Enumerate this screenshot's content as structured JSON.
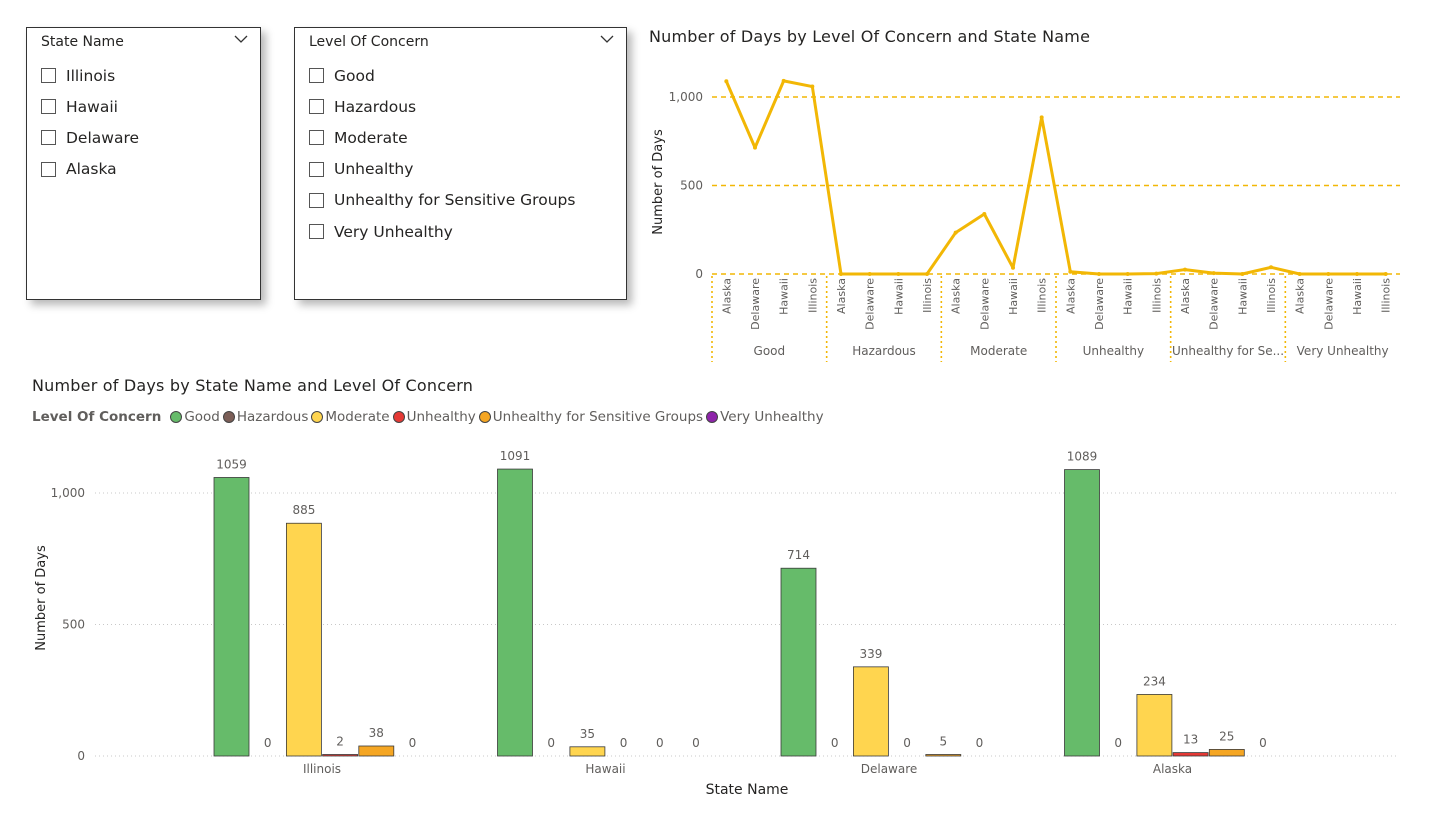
{
  "slicers": {
    "state": {
      "title": "State Name",
      "items": [
        "Illinois",
        "Hawaii",
        "Delaware",
        "Alaska"
      ]
    },
    "concern": {
      "title": "Level Of Concern",
      "items": [
        "Good",
        "Hazardous",
        "Moderate",
        "Unhealthy",
        "Unhealthy for Sensitive Groups",
        "Very Unhealthy"
      ]
    }
  },
  "colors": {
    "Good": "#66bb6a",
    "Hazardous": "#7b5e57",
    "Moderate": "#ffd54f",
    "Unhealthy": "#e53935",
    "Unhealthy for Sensitive Groups": "#f5a623",
    "Very Unhealthy": "#8e24aa",
    "line": "#f2b705"
  },
  "chart_data": [
    {
      "type": "line",
      "title": "Number of Days by Level Of Concern and State Name",
      "ylabel": "Number of Days",
      "ylim": [
        0,
        1100
      ],
      "yticks": [
        "0",
        "500",
        "1,000"
      ],
      "yticks_values": [
        0,
        500,
        1000
      ],
      "grid": true,
      "x_groups": [
        {
          "label": "Good",
          "sub": [
            "Alaska",
            "Delaware",
            "Hawaii",
            "Illinois"
          ],
          "values": [
            1089,
            714,
            1091,
            1059
          ]
        },
        {
          "label": "Hazardous",
          "sub": [
            "Alaska",
            "Delaware",
            "Hawaii",
            "Illinois"
          ],
          "values": [
            0,
            0,
            0,
            0
          ]
        },
        {
          "label": "Moderate",
          "sub": [
            "Alaska",
            "Delaware",
            "Hawaii",
            "Illinois"
          ],
          "values": [
            234,
            339,
            35,
            885
          ]
        },
        {
          "label": "Unhealthy",
          "sub": [
            "Alaska",
            "Delaware",
            "Hawaii",
            "Illinois"
          ],
          "values": [
            13,
            0,
            0,
            2
          ]
        },
        {
          "label": "Unhealthy for Se...",
          "sub": [
            "Alaska",
            "Delaware",
            "Hawaii",
            "Illinois"
          ],
          "values": [
            25,
            5,
            0,
            38
          ]
        },
        {
          "label": "Very Unhealthy",
          "sub": [
            "Alaska",
            "Delaware",
            "Hawaii",
            "Illinois"
          ],
          "values": [
            0,
            0,
            0,
            0
          ]
        }
      ]
    },
    {
      "type": "bar",
      "title": "Number of Days by State Name and Level Of Concern",
      "xlabel": "State Name",
      "ylabel": "Number of Days",
      "ylim": [
        0,
        1100
      ],
      "yticks": [
        "0",
        "500",
        "1,000"
      ],
      "yticks_values": [
        0,
        500,
        1000
      ],
      "grid": true,
      "legend_title": "Level Of Concern",
      "legend_position": "top-left",
      "categories": [
        "Illinois",
        "Hawaii",
        "Delaware",
        "Alaska"
      ],
      "series": [
        {
          "name": "Good",
          "values": [
            1059,
            1091,
            714,
            1089
          ]
        },
        {
          "name": "Hazardous",
          "values": [
            0,
            0,
            0,
            0
          ]
        },
        {
          "name": "Moderate",
          "values": [
            885,
            35,
            339,
            234
          ]
        },
        {
          "name": "Unhealthy",
          "values": [
            2,
            0,
            0,
            13
          ]
        },
        {
          "name": "Unhealthy for Sensitive Groups",
          "values": [
            38,
            0,
            5,
            25
          ]
        },
        {
          "name": "Very Unhealthy",
          "values": [
            0,
            0,
            0,
            0
          ]
        }
      ]
    }
  ]
}
